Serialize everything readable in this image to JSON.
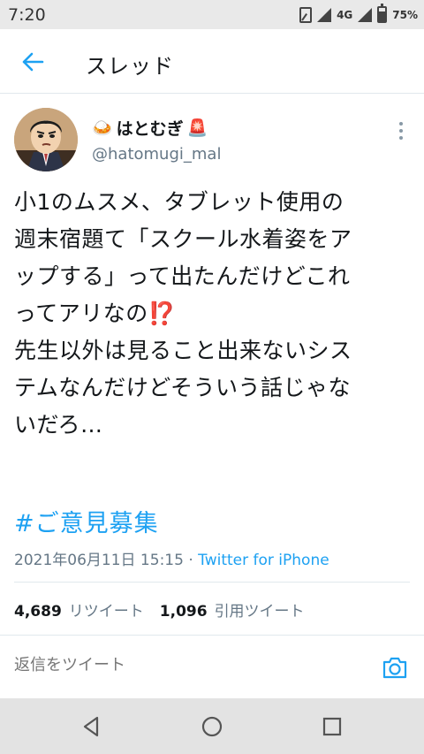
{
  "status_bar": {
    "time": "7:20",
    "network": "4G",
    "battery": "75%",
    "icons": [
      "sim-icon",
      "signal-icon",
      "battery-icon"
    ]
  },
  "header": {
    "back_icon": "arrow-left-icon",
    "title": "スレッド"
  },
  "tweet": {
    "display_name": "はとむぎ",
    "name_prefix_emoji": "🍛",
    "name_suffix_emoji": "🚨",
    "handle": "@hatomugi_mal",
    "text": "小1のムスメ、タブレット使用の\n週末宿題て「スクール水着姿をア\nップする」って出たんだけどこれ\nってアリなの⁉️\n先生以外は見ること出来ないシス\nテムなんだけどそういう話じゃな\nいだろ…",
    "hashtag": "#ご意見募集",
    "timestamp": "2021年06月11日 15:15 · ",
    "source": "Twitter for iPhone",
    "retweets_count": "4,689",
    "retweets_label": "リツイート",
    "quotes_count": "1,096",
    "quotes_label": "引用ツイート"
  },
  "reply": {
    "placeholder": "返信をツイート",
    "camera_icon": "camera-icon"
  },
  "colors": {
    "accent": "#1da1f2",
    "secondary_text": "#657786",
    "divider": "#e1e8ed"
  }
}
